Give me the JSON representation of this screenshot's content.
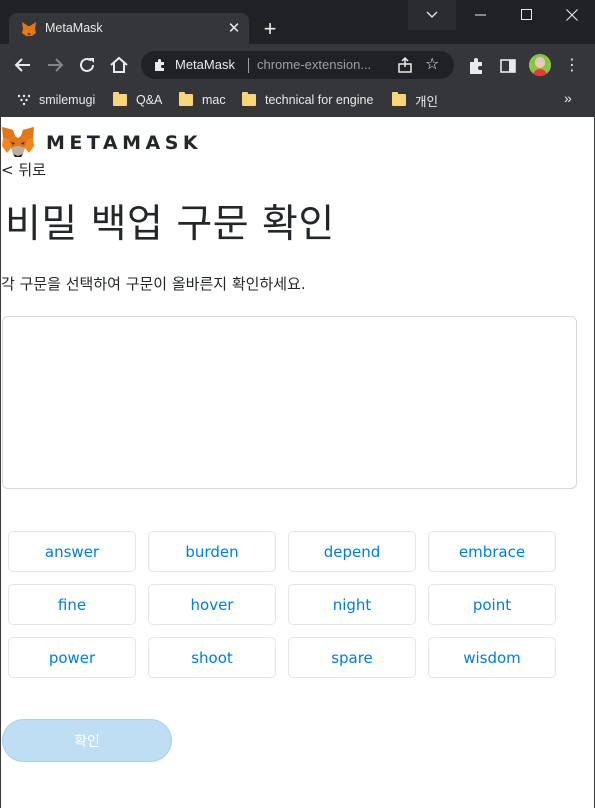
{
  "browser": {
    "tab": {
      "title": "MetaMask",
      "close_glyph": "✕"
    },
    "new_tab_glyph": "+",
    "omnibox": {
      "site_label": "MetaMask",
      "url_text": "chrome-extension..."
    },
    "bookmarks": [
      {
        "label": "smilemugi",
        "icon": "apps-grid-icon"
      },
      {
        "label": "Q&A",
        "icon": "folder-icon"
      },
      {
        "label": "mac",
        "icon": "folder-icon"
      },
      {
        "label": "technical for engine",
        "icon": "folder-icon"
      },
      {
        "label": "개인",
        "icon": "folder-icon"
      }
    ],
    "bookmarks_more": "»"
  },
  "page": {
    "brand": "METAMASK",
    "back_label": "< 뒤로",
    "title": "비밀 백업 구문 확인",
    "subtitle": "각 구문을 선택하여 구문이 올바른지 확인하세요.",
    "words": [
      "answer",
      "burden",
      "depend",
      "embrace",
      "fine",
      "hover",
      "night",
      "point",
      "power",
      "shoot",
      "spare",
      "wisdom"
    ],
    "confirm_label": "확인"
  },
  "colors": {
    "chrome_dark": "#202124",
    "chrome_toolbar": "#35363a",
    "link_blue": "#037dd6",
    "confirm_disabled": "#bfddf3",
    "text": "#24272a"
  }
}
